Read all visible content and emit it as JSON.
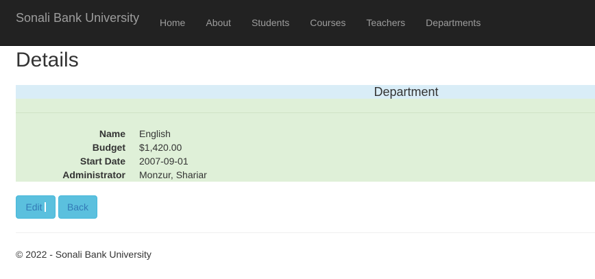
{
  "navbar": {
    "brand": "Sonali Bank University",
    "items": [
      {
        "label": "Home"
      },
      {
        "label": "About"
      },
      {
        "label": "Students"
      },
      {
        "label": "Courses"
      },
      {
        "label": "Teachers"
      },
      {
        "label": "Departments"
      }
    ]
  },
  "page": {
    "title": "Details"
  },
  "details": {
    "caption": "Department",
    "fields": [
      {
        "label": "Name",
        "value": "English"
      },
      {
        "label": "Budget",
        "value": "$1,420.00"
      },
      {
        "label": "Start Date",
        "value": "2007-09-01"
      },
      {
        "label": "Administrator",
        "value": "Monzur, Shariar"
      }
    ]
  },
  "actions": {
    "edit_label": "Edit",
    "back_label": "Back"
  },
  "footer": {
    "text": "© 2022 - Sonali Bank University"
  },
  "colors": {
    "navbar_bg": "#222222",
    "nav_text": "#9d9d9d",
    "caption_bg": "#d9edf7",
    "table_bg": "#dff0d8",
    "button_bg": "#5bc0de"
  }
}
